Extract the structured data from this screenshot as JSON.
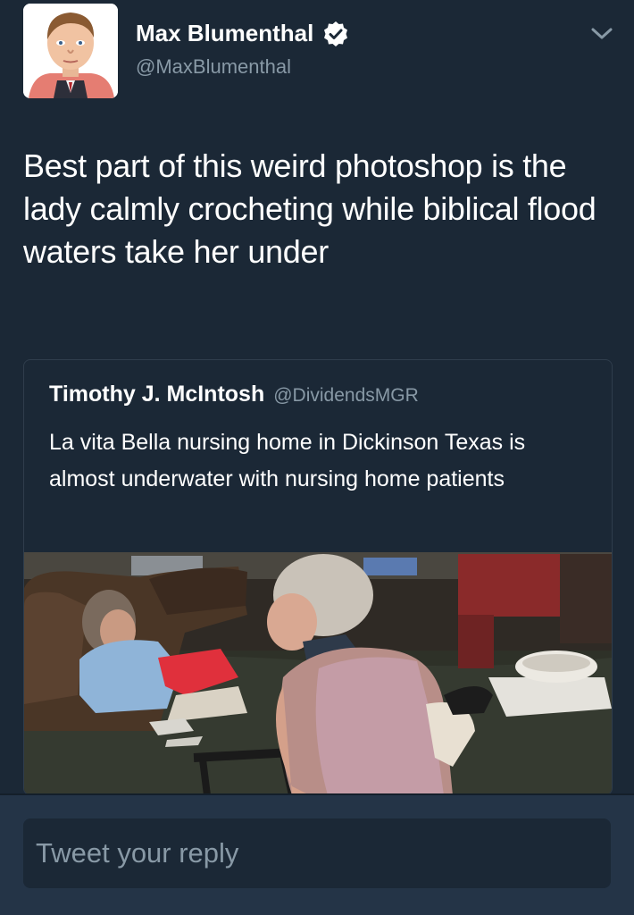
{
  "tweet": {
    "author": {
      "name": "Max Blumenthal",
      "handle": "@MaxBlumenthal",
      "verified": true,
      "avatar_icon": "cartoon-portrait-avatar"
    },
    "text": "Best part of this weird photoshop is the lady calmly crocheting while biblical flood waters take her under"
  },
  "quoted_tweet": {
    "author": {
      "name": "Timothy J. McIntosh",
      "handle": "@DividendsMGR"
    },
    "text": "La vita Bella nursing home in Dickinson Texas is almost underwater with nursing home patients",
    "media": "photo-flooded-nursing-home"
  },
  "reply": {
    "placeholder": "Tweet your reply"
  },
  "colors": {
    "background": "#1b2836",
    "reply_bar": "#243447",
    "secondary_text": "#8899a6",
    "card_border": "#2f3d4c",
    "verified_badge": "#ffffff"
  }
}
